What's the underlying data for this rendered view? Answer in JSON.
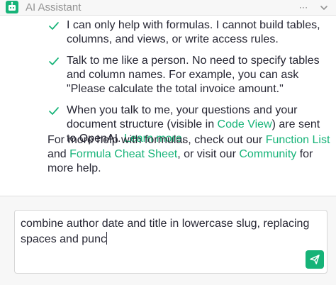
{
  "header": {
    "title": "AI Assistant",
    "menu_icon": "ellipsis-icon",
    "collapse_icon": "chevron-down-icon",
    "bot_icon": "robot-icon"
  },
  "messages": {
    "bullets": [
      {
        "icon": "checkmark-icon",
        "parts": [
          {
            "text": "I can only help with formulas. I cannot build tables, columns, and views, or write access rules.",
            "link": false
          }
        ]
      },
      {
        "icon": "checkmark-icon",
        "parts": [
          {
            "text": "Talk to me like a person. No need to specify tables and column names. For example, you can ask \"Please calculate the total invoice amount.\"",
            "link": false
          }
        ]
      },
      {
        "icon": "checkmark-icon",
        "parts": [
          {
            "text": "When you talk to me, your questions and your document structure (visible in ",
            "link": false
          },
          {
            "text": "Code View",
            "link": true
          },
          {
            "text": ") are sent to OpenAI. ",
            "link": false
          },
          {
            "text": "Learn more",
            "link": true
          },
          {
            "text": ".",
            "link": false
          }
        ]
      }
    ],
    "more_help": {
      "prefix": "For more help with formulas, check out our ",
      "function_list": "Function List",
      "and": " and ",
      "cheat_sheet": "Formula Cheat Sheet",
      "visit": ", or visit our ",
      "community": "Community",
      "suffix": " for more help."
    }
  },
  "composer": {
    "input_value": "combine author date and title in lowercase slug, replacing spaces and punc",
    "send_icon": "send-icon"
  },
  "colors": {
    "accent": "#16b378",
    "text": "#262633",
    "muted": "#929292",
    "header_bg": "#f7f7f7"
  }
}
